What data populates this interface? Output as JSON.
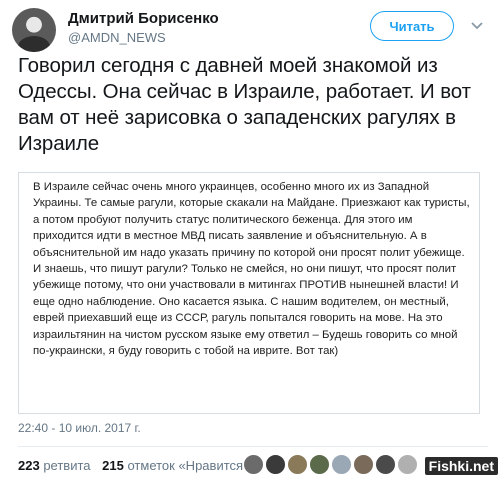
{
  "header": {
    "name": "Дмитрий Борисенко",
    "handle": "@AMDN_NEWS",
    "follow_label": "Читать"
  },
  "tweet": {
    "text": "Говорил сегодня с давней моей знакомой из Одессы. Она сейчас в Израиле, работает. И вот вам от неё зарисовка о западенских рагулях в Израиле",
    "quote_text": "В Израиле сейчас очень много украинцев, особенно много их из Западной Украины. Те самые рагули, которые скакали на Майдане. Приезжают как туристы, а потом пробуют получить статус политического беженца. Для этого им приходится идти в местное МВД писать заявление и объяснительную. А в объяснительной им надо указать причину по которой они просят полит убежище. И знаешь, что пишут рагули? Только не смейся, но они пишут, что просят полит убежище потому, что они участвовали в митингах ПРОТИВ нынешней власти! И еще одно наблюдение. Оно касается языка. С нашим водителем, он местный, еврей приехавший еще из СССР, рагуль попытался говорить на мове. На это израильтянин на чистом русском языке ему ответил – Будешь говорить со мной по-украински, я буду говорить с тобой на иврите. Вот так)",
    "timestamp": "22:40 - 10 июл. 2017 г."
  },
  "stats": {
    "retweets_count": "223",
    "retweets_label": "ретвита",
    "likes_count": "215",
    "likes_label": "отметок «Нравится»"
  },
  "likers": [
    {
      "icon": "liker-avatar-1",
      "color": "#6b6b6b"
    },
    {
      "icon": "liker-avatar-2",
      "color": "#3a3a3a"
    },
    {
      "icon": "liker-avatar-3",
      "color": "#8a7a5a"
    },
    {
      "icon": "liker-avatar-4",
      "color": "#5a6a4a"
    },
    {
      "icon": "liker-avatar-5",
      "color": "#9aa7b5"
    },
    {
      "icon": "liker-avatar-6",
      "color": "#7a6a5a"
    },
    {
      "icon": "liker-avatar-7",
      "color": "#4a4a4a"
    },
    {
      "icon": "liker-avatar-8",
      "color": "#b0b0b0"
    }
  ],
  "watermark": "Fishki.net",
  "colors": {
    "accent": "#1da1f2",
    "muted": "#657786"
  }
}
